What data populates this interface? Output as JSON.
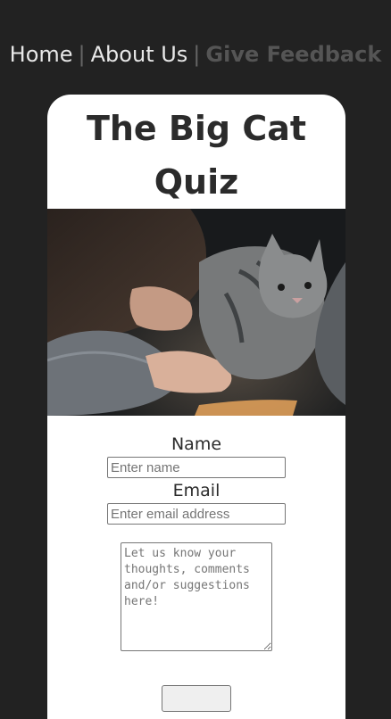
{
  "nav": {
    "items": [
      {
        "label": "Home"
      },
      {
        "label": "About Us"
      },
      {
        "label": "Give Feedback"
      }
    ],
    "separator": "|"
  },
  "card": {
    "title": "The Big Cat Quiz"
  },
  "form": {
    "name_label": "Name",
    "name_placeholder": "Enter name",
    "email_label": "Email",
    "email_placeholder": "Enter email address",
    "message_placeholder": "Let us know your thoughts, comments and/or suggestions here!"
  },
  "colors": {
    "page_background": "#222222",
    "card_background": "#ffffff",
    "title_text": "#2b2b2b",
    "nav_text": "#e8e8e8",
    "nav_active_text": "#555555"
  }
}
